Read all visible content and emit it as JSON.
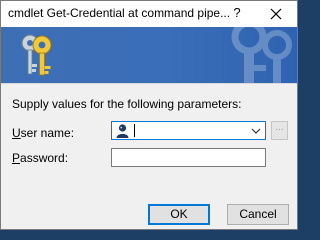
{
  "window": {
    "title": "cmdlet Get-Credential at command pipe...",
    "help_glyph": "?",
    "close_glyph": "×"
  },
  "body": {
    "prompt": "Supply values for the following parameters:"
  },
  "fields": {
    "user_label_accel": "U",
    "user_label_rest": "ser name:",
    "user_value": "",
    "password_label_accel": "P",
    "password_label_rest": "assword:",
    "password_value": ""
  },
  "buttons": {
    "browse_label": "...",
    "ok_label": "OK",
    "cancel_label": "Cancel"
  },
  "colors": {
    "banner": "#3d6fb5",
    "focus_border": "#0078d7",
    "dialog_bg": "#f0f0f0",
    "desktop_bg": "#1d3f66"
  },
  "icons": {
    "banner": "keys-icon",
    "user_field": "user-account-icon",
    "combo": "chevron-down-icon"
  }
}
